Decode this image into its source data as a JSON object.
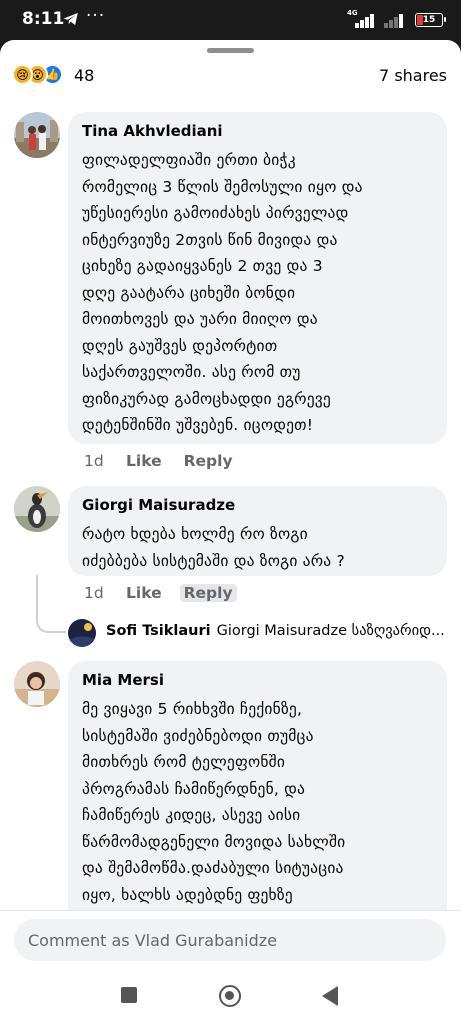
{
  "status_bar": {
    "time": "8:11",
    "network_label": "4G",
    "battery_level": "15",
    "battery_color": "#e53935",
    "icons": [
      "telegram-icon",
      "more-dots-icon",
      "signal-icon",
      "battery-icon"
    ]
  },
  "post_stats": {
    "reaction_icons": [
      "sad-icon",
      "wow-icon",
      "like-icon"
    ],
    "reaction_count": "48",
    "shares": "7 shares"
  },
  "comments": [
    {
      "author": "Tina Akhvlediani",
      "lines": [
        "ფილადელფიაში ერთი ბიჭკ",
        "რომელიც 3 წლის შემოსული იყო და",
        "უწესიერესი გამოიძახეს პირველად",
        "ინტერვიუზე 2თვის წინ მივიდა და",
        "ციხეზე გადაიყვანეს 2 თვე და 3",
        "დღე გაატარა ციხეში ბონდი",
        "მოითხოვეს და უარი მიიღო და",
        "დღეს გაუშვეს დეპორტით",
        "საქართველოში. ასე რომ თუ",
        "ფიზიკურად გამოცხადდი ეგრევე",
        "დეტენშინში უშვებენ. იცოდეთ!"
      ],
      "time": "1d",
      "like_label": "Like",
      "reply_label": "Reply"
    },
    {
      "author": "Giorgi Maisuradze",
      "lines": [
        "რატო ხდება ხოლმე რო ზოგი",
        "იძებბება სისტემაში და ზოგი არა ?"
      ],
      "time": "1d",
      "like_label": "Like",
      "reply_label": "Reply",
      "reply_preview": {
        "author": "Sofi Tsiklauri",
        "text": "Giorgi Maisuradze საზღვარიდ..."
      }
    },
    {
      "author": "Mia Mersi",
      "lines": [
        "მე ვიყავი 5 რიხხვში ჩექინზე,",
        "სისტემაში ვიძებნებოდი თუმცა",
        "მითხრეს რომ ტელეფონში",
        "პროგრამას ჩამიწერდნენ, და",
        "ჩამიწერეს კიდეც, ასევე აისი",
        "წარმომადგენელი მოვიდა სახლში",
        "და შემამოწმა.დაძაბული სიტუაცია",
        "იყო, ხალხს ადებდნე ფეხზე"
      ]
    }
  ],
  "composer": {
    "placeholder": "Comment as Vlad Gurabanidze"
  },
  "nav_bar": {
    "icons": [
      "recents-square-icon",
      "home-circle-icon",
      "back-triangle-icon"
    ]
  },
  "colors": {
    "bubble": "#f0f2f5",
    "like_blue": "#1877f2",
    "meta_gray": "#65676b"
  }
}
